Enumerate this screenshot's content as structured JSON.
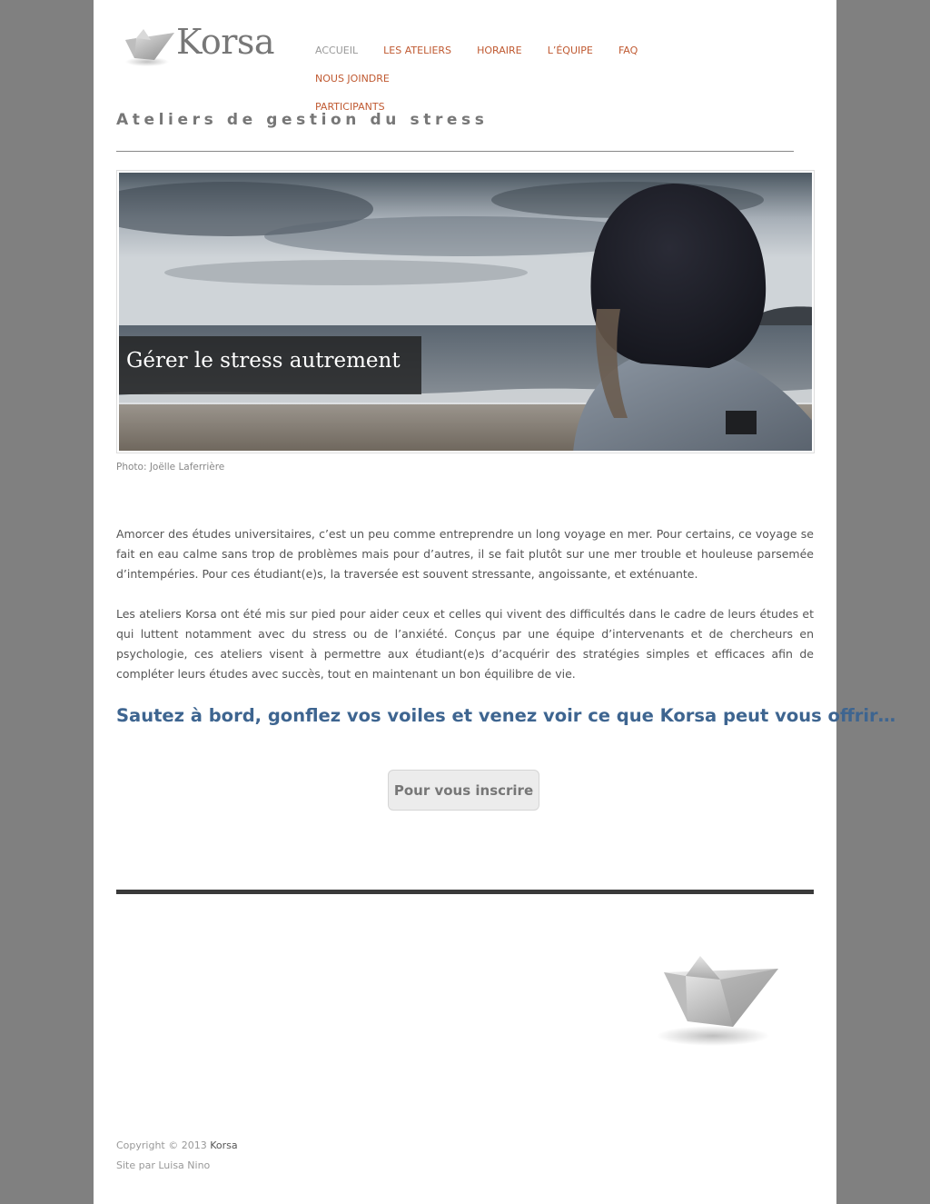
{
  "header": {
    "logo_text": "Korsa",
    "nav": [
      {
        "label": "ACCUEIL",
        "active": true
      },
      {
        "label": "LES ATELIERS",
        "active": false
      },
      {
        "label": "HORAIRE",
        "active": false
      },
      {
        "label": "L’ÉQUIPE",
        "active": false
      },
      {
        "label": "FAQ",
        "active": false
      },
      {
        "label": "NOUS JOINDRE",
        "active": false
      },
      {
        "label": "PARTICIPANTS",
        "active": false
      }
    ]
  },
  "main": {
    "page_title": "Ateliers de gestion du stress",
    "hero": {
      "caption": "Gérer le stress autrement",
      "photo_credit": "Photo: Joëlle Laferrière"
    },
    "paragraphs": [
      "Amorcer des études universitaires, c’est un peu comme entreprendre un long voyage en mer. Pour certains, ce voyage se fait en eau calme sans trop de problèmes mais pour d’autres, il se fait plutôt sur une mer trouble et houleuse parsemée d’intempéries. Pour ces étudiant(e)s, la traversée est souvent stressante, angoissante, et exténuante.",
      "Les ateliers Korsa ont été mis sur pied pour aider ceux et celles qui vivent des difficultés dans le cadre de leurs études et qui luttent notamment avec du stress ou de l’anxiété. Conçus par une équipe d’intervenants et de chercheurs en psychologie, ces ateliers visent à permettre aux étudiant(e)s d’acquérir des stratégies simples et efficaces afin de compléter leurs études avec succès, tout en maintenant un bon équilibre de vie."
    ],
    "cta_text": "Sautez à bord, gonflez vos voiles et venez voir ce que Korsa peut vous offrir…",
    "cta_button": "Pour vous inscrire"
  },
  "footer": {
    "copyright_prefix": "Copyright © 2013",
    "copyright_link": "Korsa",
    "site_credit": "Site par Luisa Nino"
  },
  "colors": {
    "nav_link": "#c05a32",
    "nav_active": "#999999",
    "cta_text": "#3e6590",
    "background": "#808080"
  }
}
